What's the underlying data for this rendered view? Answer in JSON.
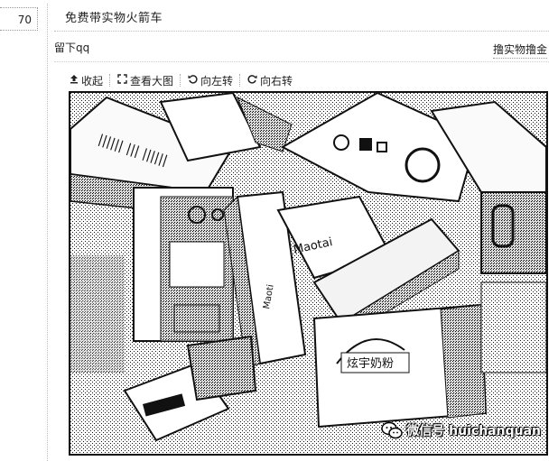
{
  "post": {
    "floor_number": "70",
    "title": "免费带实物火箭车",
    "body": "留下qq",
    "tag": "撸实物撸金"
  },
  "toolbar": {
    "collapse_label": "收起",
    "view_large_label": "查看大图",
    "rotate_left_label": "向左转",
    "rotate_right_label": "向右转"
  },
  "image": {
    "watermark": "微信号 huichanquan",
    "box_texts": [
      "Maoti",
      "Maotai",
      "炫宇奶粉"
    ]
  },
  "icons": {
    "collapse": "upload-arrow-icon",
    "view_large": "expand-icon",
    "rotate_left": "rotate-left-icon",
    "rotate_right": "rotate-right-icon",
    "wechat": "wechat-logo-icon"
  }
}
